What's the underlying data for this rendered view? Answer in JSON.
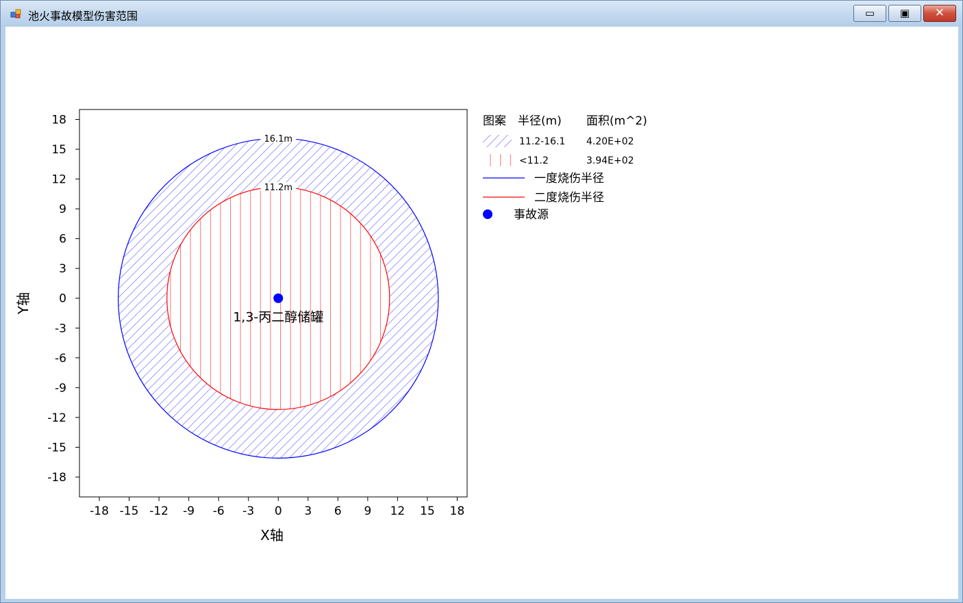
{
  "window": {
    "title": "池火事故模型伤害范围",
    "controls": {
      "minimize": "▭",
      "maximize": "▣",
      "close": "✕"
    }
  },
  "chart_data": {
    "type": "scatter",
    "xlabel": "X轴",
    "ylabel": "Y轴",
    "xlim": [
      -20,
      19
    ],
    "ylim": [
      -20,
      19
    ],
    "x_ticks": [
      "-18",
      "-15",
      "-12",
      "-9",
      "-6",
      "-3",
      "0",
      "3",
      "6",
      "9",
      "12",
      "15",
      "18"
    ],
    "y_ticks": [
      "18",
      "15",
      "12",
      "9",
      "6",
      "3",
      "0",
      "-3",
      "-6",
      "-9",
      "-12",
      "-15",
      "-18"
    ],
    "circles": [
      {
        "radius": 16.1,
        "label": "16.1m",
        "color": "#0000ff",
        "hatch": "diagonal"
      },
      {
        "radius": 11.2,
        "label": "11.2m",
        "color": "#ff0000",
        "hatch": "vertical"
      }
    ],
    "source": {
      "x": 0,
      "y": 0,
      "label": "1,3-丙二醇储罐",
      "color": "#0000ff"
    },
    "legend": {
      "placement": "right",
      "headers": [
        "图案",
        "半径(m)",
        "面积(m^2)"
      ],
      "rows": [
        {
          "pattern": "diagonal-blue",
          "radius": "11.2-16.1",
          "area": "4.20E+02"
        },
        {
          "pattern": "vertical-red",
          "radius": "<11.2",
          "area": "3.94E+02"
        }
      ],
      "lines": [
        {
          "color": "#0000ff",
          "label": "一度烧伤半径"
        },
        {
          "color": "#ff0000",
          "label": "二度烧伤半径"
        }
      ],
      "marker": {
        "color": "#0000ff",
        "label": "事故源"
      }
    }
  }
}
